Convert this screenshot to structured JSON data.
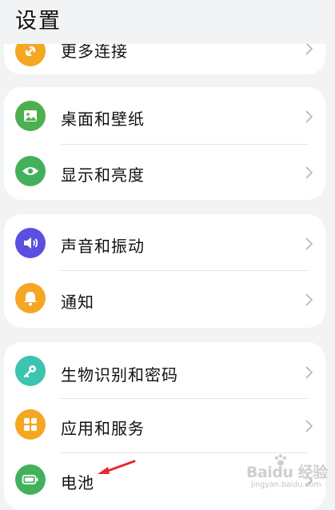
{
  "header": {
    "title": "设置"
  },
  "groups": [
    {
      "items": [
        {
          "label": "更多连接",
          "icon": "link-icon",
          "color": "#f5a623"
        }
      ]
    },
    {
      "items": [
        {
          "label": "桌面和壁纸",
          "icon": "wallpaper-icon",
          "color": "#4caf50"
        },
        {
          "label": "显示和亮度",
          "icon": "eye-icon",
          "color": "#43b05c"
        }
      ]
    },
    {
      "items": [
        {
          "label": "声音和振动",
          "icon": "speaker-icon",
          "color": "#5b4fe0"
        },
        {
          "label": "通知",
          "icon": "bell-icon",
          "color": "#f5a623"
        }
      ]
    },
    {
      "items": [
        {
          "label": "生物识别和密码",
          "icon": "key-icon",
          "color": "#3cc4b0"
        },
        {
          "label": "应用和服务",
          "icon": "apps-icon",
          "color": "#f5a623"
        },
        {
          "label": "电池",
          "icon": "battery-icon",
          "color": "#43b05c"
        }
      ]
    }
  ],
  "watermark": {
    "brand": "Baidu",
    "suffix": "经验",
    "url": "jingyan.baidu.com"
  }
}
